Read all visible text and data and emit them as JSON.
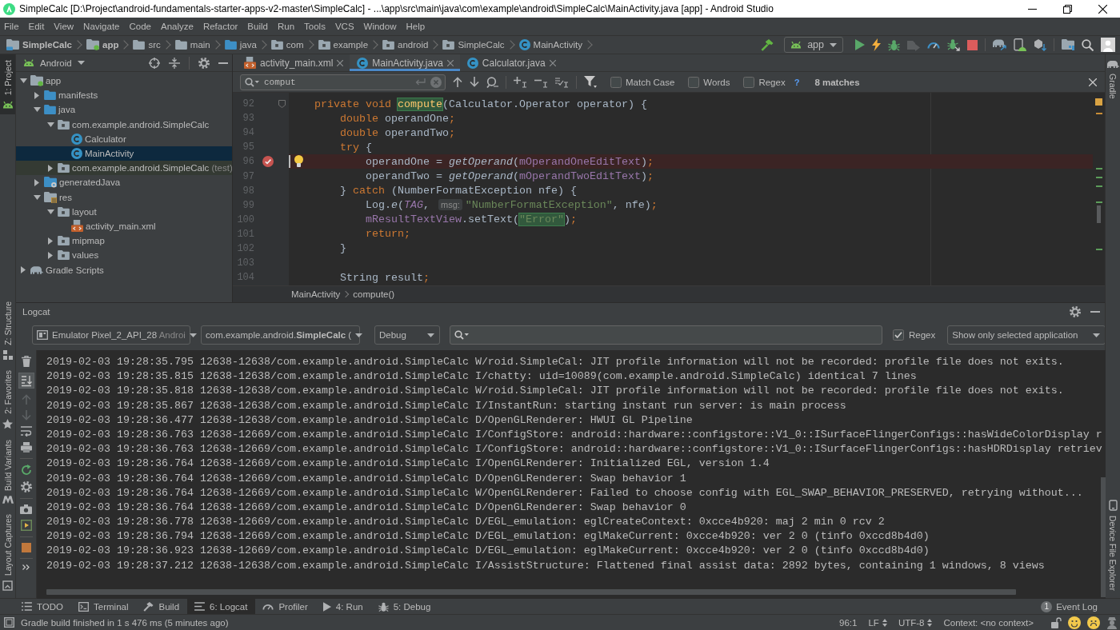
{
  "window": {
    "title": "SimpleCalc [D:\\Project\\android-fundamentals-starter-apps-v2-master\\SimpleCalc] - ...\\app\\src\\main\\java\\com\\example\\android\\SimpleCalc\\MainActivity.java [app] - Android Studio"
  },
  "menu": [
    "File",
    "Edit",
    "View",
    "Navigate",
    "Code",
    "Analyze",
    "Refactor",
    "Build",
    "Run",
    "Tools",
    "VCS",
    "Window",
    "Help"
  ],
  "breadcrumbs": [
    {
      "label": "SimpleCalc",
      "kind": "project"
    },
    {
      "label": "app",
      "kind": "module"
    },
    {
      "label": "src",
      "kind": "folder"
    },
    {
      "label": "main",
      "kind": "folder"
    },
    {
      "label": "java",
      "kind": "source-folder"
    },
    {
      "label": "com",
      "kind": "package"
    },
    {
      "label": "example",
      "kind": "package"
    },
    {
      "label": "android",
      "kind": "package"
    },
    {
      "label": "SimpleCalc",
      "kind": "package"
    },
    {
      "label": "MainActivity",
      "kind": "class"
    }
  ],
  "run_configuration": "app",
  "left_strip": {
    "top": [
      {
        "label": "1: Project",
        "kind": "project",
        "selected": true
      }
    ],
    "bottom": [
      {
        "label": "Z: Structure",
        "kind": "structure",
        "selected": false
      },
      {
        "label": "2: Favorites",
        "kind": "favorites",
        "selected": false
      },
      {
        "label": "Build Variants",
        "kind": "variants",
        "selected": false
      },
      {
        "label": "Layout Captures",
        "kind": "captures",
        "selected": false
      }
    ]
  },
  "right_strip": {
    "top": [
      {
        "label": "Gradle",
        "kind": "gradle",
        "selected": false
      }
    ],
    "bottom": [
      {
        "label": "Device File Explorer",
        "kind": "device",
        "selected": false
      }
    ]
  },
  "project_panel": {
    "view": "Android",
    "tree": [
      {
        "label": "app",
        "kind": "module",
        "expanded": true,
        "selected": false,
        "children": [
          {
            "label": "manifests",
            "kind": "source-folder",
            "expanded": false,
            "selected": false
          },
          {
            "label": "java",
            "kind": "source-folder",
            "expanded": true,
            "selected": false,
            "children": [
              {
                "label": "com.example.android.SimpleCalc",
                "kind": "package",
                "expanded": true,
                "selected": false,
                "children": [
                  {
                    "label": "Calculator",
                    "kind": "class",
                    "selected": false
                  },
                  {
                    "label": "MainActivity",
                    "kind": "class",
                    "selected": true
                  }
                ]
              },
              {
                "label": "com.example.android.SimpleCalc",
                "suffix": "(test)",
                "kind": "test-package",
                "expanded": false,
                "selected": false
              }
            ]
          },
          {
            "label": "generatedJava",
            "kind": "generated",
            "expanded": false,
            "selected": false
          },
          {
            "label": "res",
            "kind": "res",
            "expanded": true,
            "selected": false,
            "children": [
              {
                "label": "layout",
                "kind": "package",
                "expanded": true,
                "selected": false,
                "children": [
                  {
                    "label": "activity_main.xml",
                    "kind": "xml",
                    "selected": false
                  }
                ]
              },
              {
                "label": "mipmap",
                "kind": "package",
                "expanded": false,
                "selected": false
              },
              {
                "label": "values",
                "kind": "package",
                "expanded": false,
                "selected": false
              }
            ]
          }
        ]
      },
      {
        "label": "Gradle Scripts",
        "kind": "gradle",
        "expanded": false,
        "selected": false
      }
    ]
  },
  "editor": {
    "tabs": [
      {
        "label": "activity_main.xml",
        "kind": "xml",
        "selected": false
      },
      {
        "label": "MainActivity.java",
        "kind": "class",
        "selected": true
      },
      {
        "label": "Calculator.java",
        "kind": "class",
        "selected": false
      }
    ],
    "find": {
      "value": "comput",
      "options": [
        {
          "label": "Match Case",
          "checked": false
        },
        {
          "label": "Words",
          "checked": false
        },
        {
          "label": "Regex",
          "checked": false
        }
      ],
      "help": "?",
      "matches": "8 matches"
    },
    "lines": [
      {
        "number": "92",
        "fold": true,
        "breakpoint": false,
        "caret": false,
        "bulb": false,
        "tokens": [
          {
            "kind": "keyword",
            "text": "    private void "
          },
          {
            "kind": "match",
            "text": "compute"
          },
          {
            "kind": "plain",
            "text": "(Calculator.Operator operator) {"
          }
        ]
      },
      {
        "number": "93",
        "fold": false,
        "breakpoint": false,
        "caret": false,
        "bulb": false,
        "tokens": [
          {
            "kind": "keyword",
            "text": "        double "
          },
          {
            "kind": "plain",
            "text": "operandOne"
          },
          {
            "kind": "keyword",
            "text": ";"
          }
        ]
      },
      {
        "number": "94",
        "fold": false,
        "breakpoint": false,
        "caret": false,
        "bulb": false,
        "tokens": [
          {
            "kind": "keyword",
            "text": "        double "
          },
          {
            "kind": "plain",
            "text": "operandTwo"
          },
          {
            "kind": "keyword",
            "text": ";"
          }
        ]
      },
      {
        "number": "95",
        "fold": false,
        "breakpoint": false,
        "caret": false,
        "bulb": false,
        "tokens": [
          {
            "kind": "keyword",
            "text": "        try "
          },
          {
            "kind": "plain",
            "text": "{"
          }
        ]
      },
      {
        "number": "96",
        "fold": false,
        "breakpoint": true,
        "caret": true,
        "bulb": true,
        "tokens": [
          {
            "kind": "plain",
            "text": "            operandOne = "
          },
          {
            "kind": "call",
            "text": "getOperand"
          },
          {
            "kind": "plain",
            "text": "("
          },
          {
            "kind": "field",
            "text": "mOperandOneEditText"
          },
          {
            "kind": "plain",
            "text": ")"
          },
          {
            "kind": "keyword",
            "text": ";"
          }
        ]
      },
      {
        "number": "97",
        "fold": false,
        "breakpoint": false,
        "caret": false,
        "bulb": false,
        "tokens": [
          {
            "kind": "plain",
            "text": "            operandTwo = "
          },
          {
            "kind": "call",
            "text": "getOperand"
          },
          {
            "kind": "plain",
            "text": "("
          },
          {
            "kind": "field",
            "text": "mOperandTwoEditText"
          },
          {
            "kind": "plain",
            "text": ")"
          },
          {
            "kind": "keyword",
            "text": ";"
          }
        ]
      },
      {
        "number": "98",
        "fold": false,
        "breakpoint": false,
        "caret": false,
        "bulb": false,
        "tokens": [
          {
            "kind": "plain",
            "text": "        } "
          },
          {
            "kind": "keyword",
            "text": "catch "
          },
          {
            "kind": "plain",
            "text": "(NumberFormatException nfe) {"
          }
        ]
      },
      {
        "number": "99",
        "fold": false,
        "breakpoint": false,
        "caret": false,
        "bulb": false,
        "tokens": [
          {
            "kind": "plain",
            "text": "            Log."
          },
          {
            "kind": "call",
            "text": "e"
          },
          {
            "kind": "plain",
            "text": "("
          },
          {
            "kind": "constant",
            "text": "TAG"
          },
          {
            "kind": "plain",
            "text": ", "
          },
          {
            "kind": "hint",
            "text": "msg:"
          },
          {
            "kind": "string",
            "text": "\"NumberFormatException\""
          },
          {
            "kind": "plain",
            "text": ", nfe)"
          },
          {
            "kind": "keyword",
            "text": ";"
          }
        ]
      },
      {
        "number": "100",
        "fold": false,
        "breakpoint": false,
        "caret": false,
        "bulb": false,
        "tokens": [
          {
            "kind": "field",
            "text": "            mResultTextView"
          },
          {
            "kind": "plain",
            "text": ".setText("
          },
          {
            "kind": "string-match",
            "text": "\"Error\""
          },
          {
            "kind": "plain",
            "text": ")"
          },
          {
            "kind": "keyword",
            "text": ";"
          }
        ]
      },
      {
        "number": "101",
        "fold": false,
        "breakpoint": false,
        "caret": false,
        "bulb": false,
        "tokens": [
          {
            "kind": "keyword",
            "text": "            return;"
          }
        ]
      },
      {
        "number": "102",
        "fold": false,
        "breakpoint": false,
        "caret": false,
        "bulb": false,
        "tokens": [
          {
            "kind": "plain",
            "text": "        }"
          }
        ]
      },
      {
        "number": "103",
        "fold": false,
        "breakpoint": false,
        "caret": false,
        "bulb": false
      },
      {
        "number": "104",
        "fold": false,
        "breakpoint": false,
        "caret": false,
        "bulb": false,
        "tokens": [
          {
            "kind": "plain",
            "text": "        String result"
          },
          {
            "kind": "keyword",
            "text": ";"
          }
        ]
      }
    ],
    "breadcrumb": [
      "MainActivity",
      "compute()"
    ]
  },
  "logcat": {
    "title": "Logcat",
    "device": {
      "name": "Emulator Pixel_2_API_28",
      "detail": "Androi"
    },
    "process": "com.example.android.**SimpleCalc** (",
    "level": "Debug",
    "regex": {
      "label": "Regex",
      "checked": true
    },
    "filter": "Show only selected application",
    "autoscroll": true,
    "lines": [
      "2019-02-03 19:28:35.795 12638-12638/com.example.android.SimpleCalc W/roid.SimpleCal: JIT profile information will not be recorded: profile file does not exits.",
      "2019-02-03 19:28:35.815 12638-12638/com.example.android.SimpleCalc I/chatty: uid=10089(com.example.android.SimpleCalc) identical 7 lines",
      "2019-02-03 19:28:35.818 12638-12638/com.example.android.SimpleCalc W/roid.SimpleCal: JIT profile information will not be recorded: profile file does not exits.",
      "2019-02-03 19:28:35.867 12638-12638/com.example.android.SimpleCalc I/InstantRun: starting instant run server: is main process",
      "2019-02-03 19:28:36.477 12638-12638/com.example.android.SimpleCalc D/OpenGLRenderer: HWUI GL Pipeline",
      "2019-02-03 19:28:36.763 12638-12669/com.example.android.SimpleCalc I/ConfigStore: android::hardware::configstore::V1_0::ISurfaceFlingerConfigs::hasWideColorDisplay r",
      "2019-02-03 19:28:36.763 12638-12669/com.example.android.SimpleCalc I/ConfigStore: android::hardware::configstore::V1_0::ISurfaceFlingerConfigs::hasHDRDisplay retriev",
      "2019-02-03 19:28:36.764 12638-12669/com.example.android.SimpleCalc I/OpenGLRenderer: Initialized EGL, version 1.4",
      "2019-02-03 19:28:36.764 12638-12669/com.example.android.SimpleCalc D/OpenGLRenderer: Swap behavior 1",
      "2019-02-03 19:28:36.764 12638-12669/com.example.android.SimpleCalc W/OpenGLRenderer: Failed to choose config with EGL_SWAP_BEHAVIOR_PRESERVED, retrying without...",
      "2019-02-03 19:28:36.764 12638-12669/com.example.android.SimpleCalc D/OpenGLRenderer: Swap behavior 0",
      "2019-02-03 19:28:36.778 12638-12669/com.example.android.SimpleCalc D/EGL_emulation: eglCreateContext: 0xcce4b920: maj 2 min 0 rcv 2",
      "2019-02-03 19:28:36.794 12638-12669/com.example.android.SimpleCalc D/EGL_emulation: eglMakeCurrent: 0xcce4b920: ver 2 0 (tinfo 0xccd8b4d0)",
      "2019-02-03 19:28:36.923 12638-12669/com.example.android.SimpleCalc D/EGL_emulation: eglMakeCurrent: 0xcce4b920: ver 2 0 (tinfo 0xccd8b4d0)",
      "2019-02-03 19:28:37.212 12638-12638/com.example.android.SimpleCalc I/AssistStructure: Flattened final assist data: 2892 bytes, containing 1 windows, 8 views"
    ]
  },
  "tool_windows": [
    {
      "label": "TODO",
      "kind": "todo",
      "selected": false
    },
    {
      "label": "Terminal",
      "kind": "terminal",
      "selected": false
    },
    {
      "label": "Build",
      "kind": "build",
      "selected": false
    },
    {
      "label": "6: Logcat",
      "kind": "logcat",
      "selected": true
    },
    {
      "label": "Profiler",
      "kind": "profiler",
      "selected": false
    },
    {
      "label": "4: Run",
      "kind": "run",
      "selected": false
    },
    {
      "label": "5: Debug",
      "kind": "debug",
      "selected": false
    }
  ],
  "event_log": {
    "label": "Event Log",
    "count": "1"
  },
  "status_bar": {
    "message": "Gradle build finished in 1 s 476 ms (5 minutes ago)",
    "position": "96:1",
    "line_separator": "LF",
    "encoding": "UTF-8",
    "context": "Context: <no context>"
  }
}
